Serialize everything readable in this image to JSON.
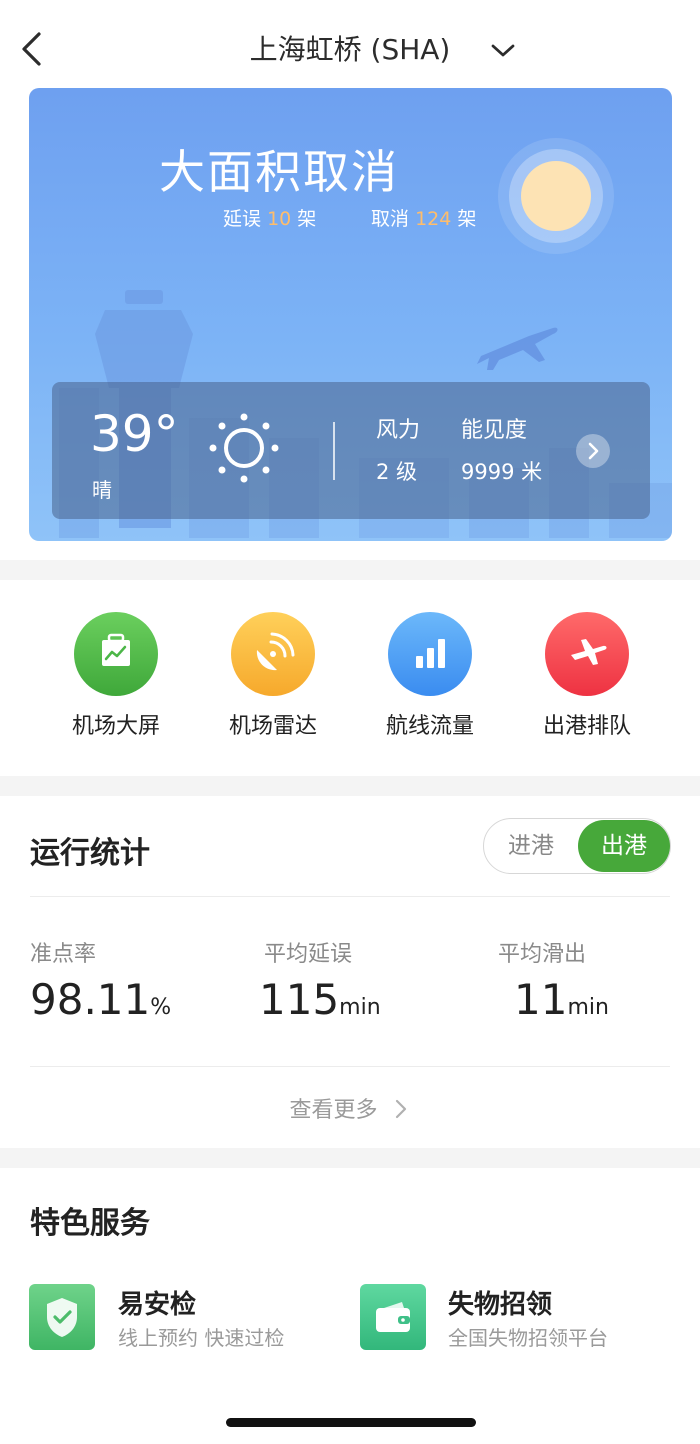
{
  "header": {
    "title": "上海虹桥 (SHA)",
    "back_icon": "chevron-left-icon",
    "dropdown_icon": "chevron-down-icon"
  },
  "hero": {
    "status_title": "大面积取消",
    "delay_label": "延误",
    "delay_count": "10",
    "delay_unit": "架",
    "cancel_label": "取消",
    "cancel_count": "124",
    "cancel_unit": "架",
    "weather": {
      "temperature": "39°",
      "condition": "晴",
      "wind_label": "风力",
      "wind_value": "2 级",
      "visibility_label": "能见度",
      "visibility_value": "9999 米"
    },
    "colors": {
      "accent_number": "#ffbd6b",
      "sky": "#6ea0f0"
    }
  },
  "quick_entries": [
    {
      "label": "机场大屏",
      "icon": "screen-icon",
      "color": "#4cb648"
    },
    {
      "label": "机场雷达",
      "icon": "radar-icon",
      "color": "#f7b73c"
    },
    {
      "label": "航线流量",
      "icon": "bar-chart-icon",
      "color": "#3f9bf4"
    },
    {
      "label": "出港排队",
      "icon": "plane-icon",
      "color": "#f2434c"
    }
  ],
  "stats": {
    "title": "运行统计",
    "toggle": {
      "arrival": "进港",
      "departure": "出港",
      "selected": "出港"
    },
    "items": [
      {
        "label": "准点率",
        "value": "98.11",
        "unit": "%"
      },
      {
        "label": "平均延误",
        "value": "115",
        "unit": "min"
      },
      {
        "label": "平均滑出",
        "value": "11",
        "unit": "min"
      }
    ],
    "more": "查看更多"
  },
  "services": {
    "title": "特色服务",
    "items": [
      {
        "title": "易安检",
        "subtitle": "线上预约 快速过检",
        "icon": "shield-check-icon",
        "color": "#4cbc6a"
      },
      {
        "title": "失物招领",
        "subtitle": "全国失物招领平台",
        "icon": "wallet-icon",
        "color": "#3fc088"
      }
    ]
  }
}
